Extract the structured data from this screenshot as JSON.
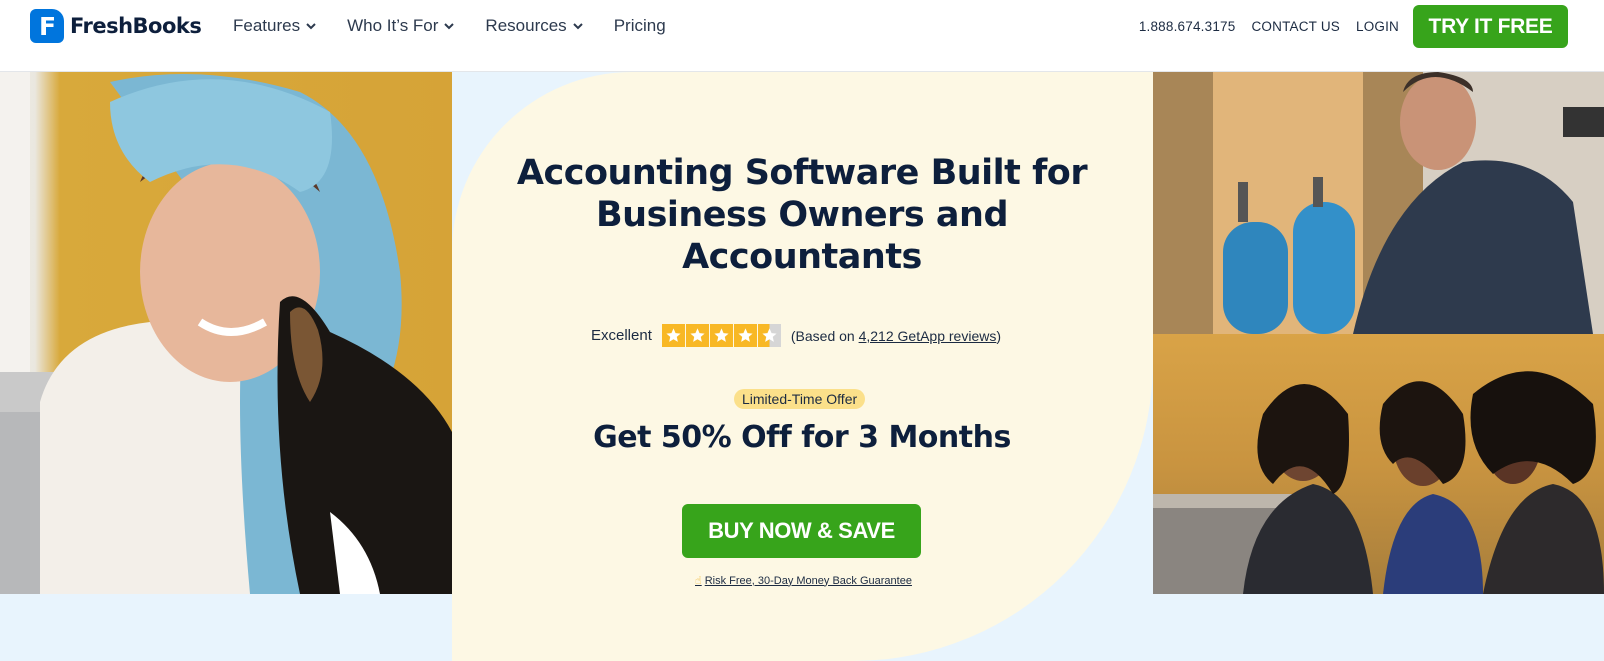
{
  "brand": {
    "name": "FreshBooks",
    "logo_letter": "F",
    "color": "#0075dd"
  },
  "nav": {
    "items": [
      {
        "label": "Features",
        "dropdown": true
      },
      {
        "label": "Who It’s For",
        "dropdown": true
      },
      {
        "label": "Resources",
        "dropdown": true
      },
      {
        "label": "Pricing",
        "dropdown": false
      }
    ]
  },
  "utility": {
    "phone": "1.888.674.3175",
    "contact": "CONTACT US",
    "login": "LOGIN"
  },
  "cta_header": {
    "label": "TRY IT FREE",
    "color": "#37a41b"
  },
  "hero": {
    "title": "Accounting Software Built for Business Owners and Accountants",
    "rating": {
      "label": "Excellent",
      "stars": 4.5,
      "based_on_prefix": "(Based on ",
      "reviews_link": "4,212 GetApp reviews",
      "based_on_suffix": ")"
    },
    "offer_badge": "Limited-Time Offer",
    "offer_headline": "Get 50% Off for 3 Months",
    "buy_button": "BUY NOW & SAVE",
    "guarantee": "Risk Free, 30-Day Money Back Guarantee",
    "panel_color": "#fdf8e4"
  }
}
